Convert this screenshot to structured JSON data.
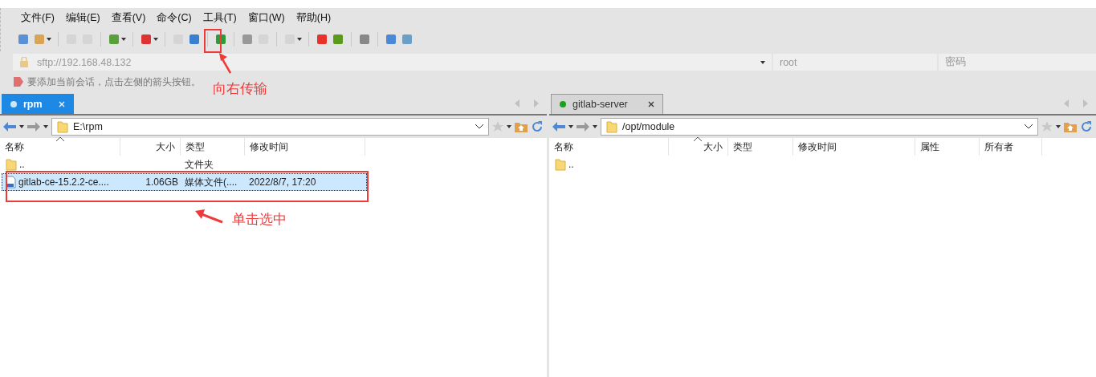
{
  "menu": [
    "文件(F)",
    "编辑(E)",
    "查看(V)",
    "命令(C)",
    "工具(T)",
    "窗口(W)",
    "帮助(H)"
  ],
  "connection": {
    "address": "sftp://192.168.48.132",
    "user": "root",
    "password_placeholder": "密码"
  },
  "hint": "要添加当前会话，点击左侧的箭头按钮。",
  "panes": [
    {
      "tab": {
        "label": "rpm",
        "selected": true,
        "color": "#cfe6f8"
      },
      "path": "E:\\rpm",
      "columns": [
        "名称",
        "大小",
        "类型",
        "修改时间"
      ],
      "rows": [
        {
          "kind": "folder",
          "selected": false,
          "cells": [
            "..",
            "",
            "文件夹",
            ""
          ]
        },
        {
          "kind": "file",
          "selected": true,
          "cells": [
            "gitlab-ce-15.2.2-ce....",
            "1.06GB",
            "媒体文件(....",
            "2022/8/7, 17:20"
          ]
        }
      ]
    },
    {
      "tab": {
        "label": "gitlab-server",
        "selected": false,
        "color": "#1aa31a"
      },
      "path": "/opt/module",
      "columns": [
        "名称",
        "大小",
        "类型",
        "修改时间",
        "属性",
        "所有者"
      ],
      "rows": [
        {
          "kind": "folder",
          "selected": false,
          "cells": [
            ".."
          ]
        }
      ]
    }
  ],
  "annotations": [
    {
      "text": "向右传输"
    },
    {
      "text": "单击选中"
    }
  ]
}
